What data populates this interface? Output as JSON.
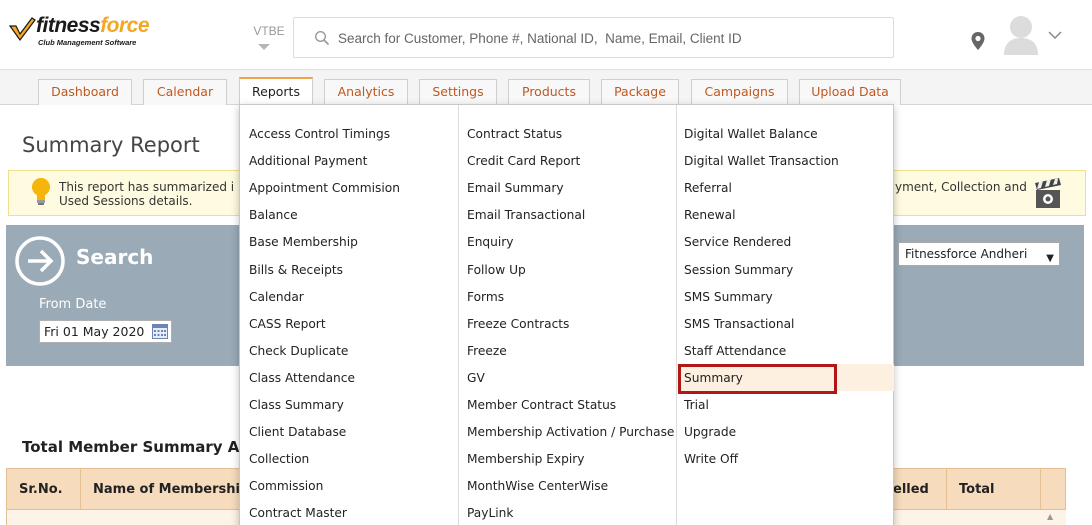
{
  "header": {
    "logo_main": "fitness",
    "logo_accent": "force",
    "logo_tagline": "Club Management Software",
    "center_code": "VTBE",
    "search_placeholder": "Search for Customer, Phone #, National ID,  Name, Email, Client ID"
  },
  "tabs": [
    {
      "label": "Dashboard",
      "active": false
    },
    {
      "label": "Calendar",
      "active": false
    },
    {
      "label": "Reports",
      "active": true
    },
    {
      "label": "Analytics",
      "active": false
    },
    {
      "label": "Settings",
      "active": false
    },
    {
      "label": "Products",
      "active": false
    },
    {
      "label": "Package",
      "active": false
    },
    {
      "label": "Campaigns",
      "active": false
    },
    {
      "label": "Upload Data",
      "active": false
    }
  ],
  "page": {
    "title": "Summary Report",
    "info_left_line1": "This report has summarized i",
    "info_left_line2": "Used Sessions details.",
    "info_right": "yment, Collection and",
    "search_label": "Search",
    "from_date_label": "From Date",
    "from_date_value": "Fri 01 May 2020",
    "branch_value": "Fitnessforce Andheri",
    "total_title": "Total Member Summary A"
  },
  "table": {
    "headers": [
      "Sr.No.",
      "Name of Membership",
      "elled",
      "Total"
    ]
  },
  "reports_menu": {
    "columns": [
      [
        "Access Control Timings",
        "Additional Payment",
        "Appointment Commision",
        "Balance",
        "Base Membership",
        "Bills & Receipts",
        "Calendar",
        "CASS Report",
        "Check Duplicate",
        "Class Attendance",
        "Class Summary",
        "Client Database",
        "Collection",
        "Commission",
        "Contract Master"
      ],
      [
        "Contract Status",
        "Credit Card Report",
        "Email Summary",
        "Email Transactional",
        "Enquiry",
        "Follow Up",
        "Forms",
        "Freeze Contracts",
        "Freeze",
        "GV",
        "Member Contract Status",
        "Membership Activation / Purchase",
        "Membership Expiry",
        "MonthWise CenterWise",
        "PayLink"
      ],
      [
        "Digital Wallet Balance",
        "Digital Wallet Transaction",
        "Referral",
        "Renewal",
        "Service Rendered",
        "Session Summary",
        "SMS Summary",
        "SMS Transactional",
        "Staff Attendance",
        "Summary",
        "Trial",
        "Upgrade",
        "Write Off"
      ]
    ],
    "highlighted": "Summary"
  },
  "colors": {
    "brand_orange": "#f5a623",
    "tab_text": "#c0581f",
    "panel": "#9aaab6",
    "table_header": "#f6dcbd",
    "highlight_border": "#b01818"
  }
}
